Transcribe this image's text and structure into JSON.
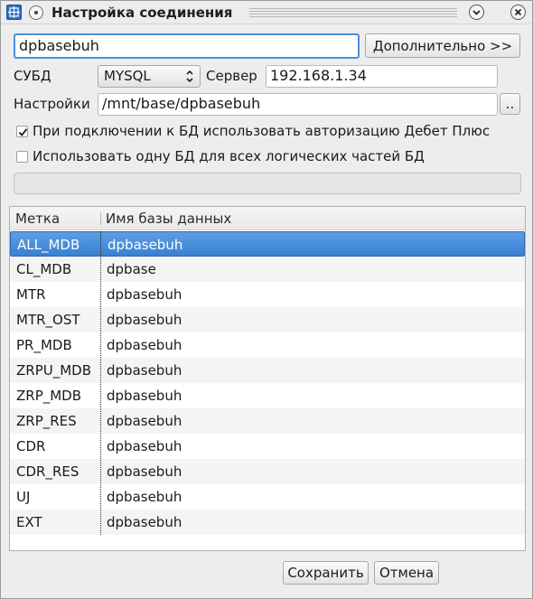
{
  "window": {
    "title": "Настройка соединения"
  },
  "form": {
    "connection_name": "dpbasebuh",
    "advanced_button": "Дополнительно >>",
    "dbms_label": "СУБД",
    "dbms_value": "MYSQL",
    "server_label": "Сервер",
    "server_value": "192.168.1.34",
    "settings_label": "Настройки",
    "settings_value": "/mnt/base/dpbasebuh",
    "browse_button": "..",
    "auth_checkbox_label": "При подключении к БД использовать авторизацию Дебет Плюс",
    "auth_checked": true,
    "single_db_checkbox_label": "Использовать одну БД для всех логических частей БД",
    "single_db_checked": false
  },
  "table": {
    "columns": [
      "Метка",
      "Имя базы данных"
    ],
    "selected_index": 0,
    "rows": [
      [
        "ALL_MDB",
        "dpbasebuh"
      ],
      [
        "CL_MDB",
        "dpbase"
      ],
      [
        "MTR",
        "dpbasebuh"
      ],
      [
        "MTR_OST",
        "dpbasebuh"
      ],
      [
        "PR_MDB",
        "dpbasebuh"
      ],
      [
        "ZRPU_MDB",
        "dpbasebuh"
      ],
      [
        "ZRP_MDB",
        "dpbasebuh"
      ],
      [
        "ZRP_RES",
        "dpbasebuh"
      ],
      [
        "CDR",
        "dpbasebuh"
      ],
      [
        "CDR_RES",
        "dpbasebuh"
      ],
      [
        "UJ",
        "dpbasebuh"
      ],
      [
        "EXT",
        "dpbasebuh"
      ]
    ]
  },
  "footer": {
    "save_button": "Сохранить",
    "cancel_button": "Отмена"
  },
  "colors": {
    "selection": "#3d84d6",
    "focus_ring": "#4a90d9",
    "window_bg": "#ededed"
  },
  "icons": {
    "app": "app-icon",
    "menu": "menu-circle-icon",
    "minimize": "chevron-down-icon",
    "close": "close-icon",
    "select_arrows": "updown-arrows-icon",
    "checkmark": "checkmark-icon"
  }
}
